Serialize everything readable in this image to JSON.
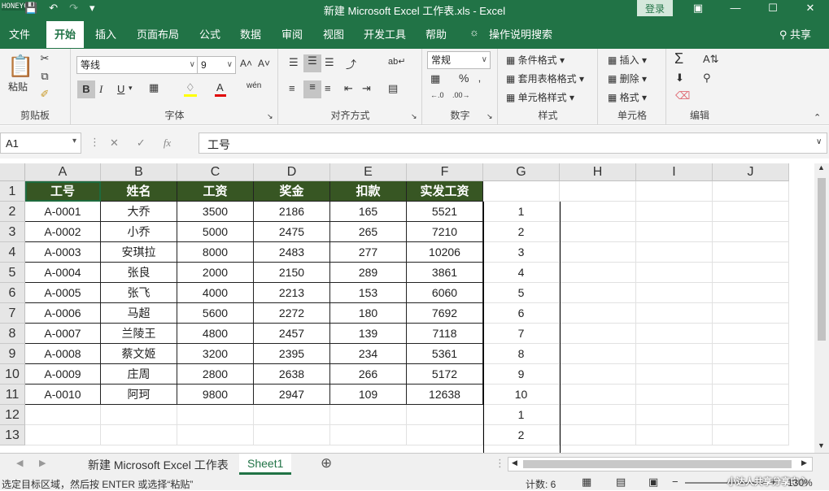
{
  "watermark": "HONEYCAM",
  "titlebar": {
    "title": "新建 Microsoft Excel 工作表.xls  -  Excel",
    "login": "登录",
    "quick_access": [
      "💾",
      "↶",
      "↷",
      "▾"
    ],
    "window_buttons": [
      "▣",
      "—",
      "☐",
      "✕"
    ]
  },
  "tabs": [
    "文件",
    "开始",
    "插入",
    "页面布局",
    "公式",
    "数据",
    "审阅",
    "视图",
    "开发工具",
    "帮助",
    "操作说明搜索"
  ],
  "share": "共享",
  "ribbon": {
    "clipboard": {
      "paste": "粘贴",
      "label": "剪贴板"
    },
    "font": {
      "name": "等线",
      "size": "9",
      "bold": "B",
      "italic": "I",
      "underline": "U",
      "label": "字体",
      "grow": "A˄",
      "shrink": "A˅",
      "wen": "wén"
    },
    "align": {
      "label": "对齐方式"
    },
    "number": {
      "format": "常规",
      "label": "数字",
      "percent": "%"
    },
    "styles": {
      "conditional": "条件格式",
      "table": "套用表格格式",
      "cell": "单元格样式",
      "label": "样式"
    },
    "cells": {
      "insert": "插入",
      "delete": "删除",
      "format": "格式",
      "label": "单元格"
    },
    "editing": {
      "sum": "Σ",
      "label": "编辑"
    }
  },
  "formula_bar": {
    "name_box": "A1",
    "cancel": "✕",
    "enter": "✓",
    "fx": "fx",
    "content": "工号"
  },
  "grid": {
    "columns": [
      "A",
      "B",
      "C",
      "D",
      "E",
      "F",
      "G",
      "H",
      "I",
      "J"
    ],
    "rows": [
      "1",
      "2",
      "3",
      "4",
      "5",
      "6",
      "7",
      "8",
      "9",
      "10",
      "11",
      "12",
      "13"
    ],
    "header": [
      "工号",
      "姓名",
      "工资",
      "奖金",
      "扣款",
      "实发工资"
    ],
    "data": [
      [
        "A-0001",
        "大乔",
        "3500",
        "2186",
        "165",
        "5521"
      ],
      [
        "A-0002",
        "小乔",
        "5000",
        "2475",
        "265",
        "7210"
      ],
      [
        "A-0003",
        "安琪拉",
        "8000",
        "2483",
        "277",
        "10206"
      ],
      [
        "A-0004",
        "张良",
        "2000",
        "2150",
        "289",
        "3861"
      ],
      [
        "A-0005",
        "张飞",
        "4000",
        "2213",
        "153",
        "6060"
      ],
      [
        "A-0006",
        "马超",
        "5600",
        "2272",
        "180",
        "7692"
      ],
      [
        "A-0007",
        "兰陵王",
        "4800",
        "2457",
        "139",
        "7118"
      ],
      [
        "A-0008",
        "蔡文姬",
        "3200",
        "2395",
        "234",
        "5361"
      ],
      [
        "A-0009",
        "庄周",
        "2800",
        "2638",
        "266",
        "5172"
      ],
      [
        "A-0010",
        "阿珂",
        "9800",
        "2947",
        "109",
        "12638"
      ]
    ],
    "col_g": [
      "1",
      "2",
      "3",
      "4",
      "5",
      "6",
      "7",
      "8",
      "9",
      "10",
      "1",
      "2"
    ],
    "header_fill": "#375623"
  },
  "sheets": [
    "新建 Microsoft Excel 工作表",
    "Sheet1"
  ],
  "add_sheet": "⊕",
  "status": {
    "message": "选定目标区域，然后按 ENTER 或选择“粘贴”",
    "count": "计数: 6",
    "zoom": "130%",
    "watermark_br": "小达人共享分享中心"
  },
  "accent": "#217346"
}
